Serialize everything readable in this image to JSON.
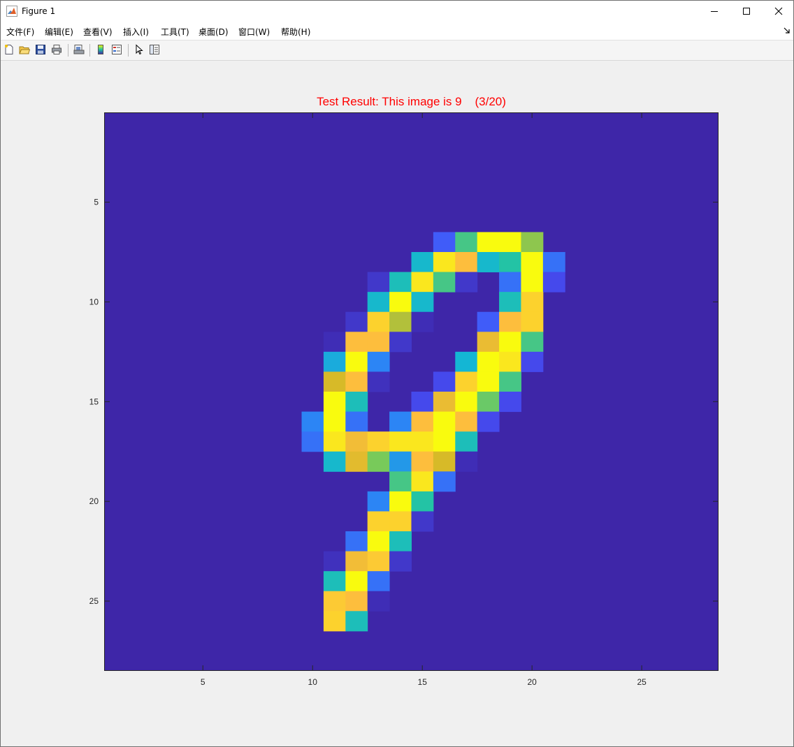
{
  "window": {
    "title": "Figure 1",
    "controls": [
      "minimize",
      "maximize",
      "close"
    ]
  },
  "menu": [
    {
      "label": "文件(F)"
    },
    {
      "label": "编辑(E)"
    },
    {
      "label": "查看(V)"
    },
    {
      "label": "插入(I)"
    },
    {
      "label": "工具(T)"
    },
    {
      "label": "桌面(D)"
    },
    {
      "label": "窗口(W)"
    },
    {
      "label": "帮助(H)"
    }
  ],
  "toolbar": {
    "icons": [
      "new-figure-icon",
      "open-file-icon",
      "save-icon",
      "print-icon",
      "print-preview-icon",
      "colorbar-icon",
      "legend-icon",
      "pointer-icon",
      "property-editor-icon"
    ]
  },
  "plot": {
    "title": "Test Result: This image is 9    (3/20)",
    "title_color": "#ff0000",
    "background_color": "#3e26a8"
  },
  "chart_data": {
    "type": "heatmap",
    "title": "Test Result: This image is 9    (3/20)",
    "xlabel": "",
    "ylabel": "",
    "xlim": [
      0.5,
      28.5
    ],
    "ylim": [
      28.5,
      0.5
    ],
    "y_reversed": true,
    "xticks": [
      5,
      10,
      15,
      20,
      25
    ],
    "yticks": [
      5,
      10,
      15,
      20,
      25
    ],
    "colormap": "parula",
    "clim": [
      0,
      1
    ],
    "grid": false,
    "rows": 28,
    "cols": 28,
    "values": [
      [
        0,
        0,
        0,
        0,
        0,
        0,
        0,
        0,
        0,
        0,
        0,
        0,
        0,
        0,
        0,
        0,
        0,
        0,
        0,
        0,
        0,
        0,
        0,
        0,
        0,
        0,
        0,
        0
      ],
      [
        0,
        0,
        0,
        0,
        0,
        0,
        0,
        0,
        0,
        0,
        0,
        0,
        0,
        0,
        0,
        0,
        0,
        0,
        0,
        0,
        0,
        0,
        0,
        0,
        0,
        0,
        0,
        0
      ],
      [
        0,
        0,
        0,
        0,
        0,
        0,
        0,
        0,
        0,
        0,
        0,
        0,
        0,
        0,
        0,
        0,
        0,
        0,
        0,
        0,
        0,
        0,
        0,
        0,
        0,
        0,
        0,
        0
      ],
      [
        0,
        0,
        0,
        0,
        0,
        0,
        0,
        0,
        0,
        0,
        0,
        0,
        0,
        0,
        0,
        0,
        0,
        0,
        0,
        0,
        0,
        0,
        0,
        0,
        0,
        0,
        0,
        0
      ],
      [
        0,
        0,
        0,
        0,
        0,
        0,
        0,
        0,
        0,
        0,
        0,
        0,
        0,
        0,
        0,
        0,
        0,
        0,
        0,
        0,
        0,
        0,
        0,
        0,
        0,
        0,
        0,
        0
      ],
      [
        0,
        0,
        0,
        0,
        0,
        0,
        0,
        0,
        0,
        0,
        0,
        0,
        0,
        0,
        0,
        0,
        0,
        0,
        0,
        0,
        0,
        0,
        0,
        0,
        0,
        0,
        0,
        0
      ],
      [
        0,
        0,
        0,
        0,
        0,
        0,
        0,
        0,
        0,
        0,
        0,
        0,
        0,
        0,
        0,
        0.15,
        0.55,
        1.0,
        1.0,
        0.65,
        0,
        0,
        0,
        0,
        0,
        0,
        0,
        0
      ],
      [
        0,
        0,
        0,
        0,
        0,
        0,
        0,
        0,
        0,
        0,
        0,
        0,
        0,
        0,
        0.4,
        0.95,
        0.85,
        0.4,
        0.5,
        1.0,
        0.2,
        0,
        0,
        0,
        0,
        0,
        0,
        0
      ],
      [
        0,
        0,
        0,
        0,
        0,
        0,
        0,
        0,
        0,
        0,
        0,
        0,
        0.05,
        0.45,
        0.95,
        0.55,
        0.05,
        0,
        0.2,
        1.0,
        0.1,
        0,
        0,
        0,
        0,
        0,
        0,
        0
      ],
      [
        0,
        0,
        0,
        0,
        0,
        0,
        0,
        0,
        0,
        0,
        0,
        0,
        0.4,
        1.0,
        0.4,
        0,
        0,
        0,
        0.45,
        0.9,
        0,
        0,
        0,
        0,
        0,
        0,
        0,
        0
      ],
      [
        0,
        0,
        0,
        0,
        0,
        0,
        0,
        0,
        0,
        0,
        0,
        0.05,
        0.9,
        0.7,
        0.02,
        0,
        0,
        0.15,
        0.85,
        0.9,
        0,
        0,
        0,
        0,
        0,
        0,
        0,
        0
      ],
      [
        0,
        0,
        0,
        0,
        0,
        0,
        0,
        0,
        0,
        0,
        0.02,
        0.85,
        0.85,
        0.05,
        0,
        0,
        0,
        0.8,
        1.0,
        0.55,
        0,
        0,
        0,
        0,
        0,
        0,
        0,
        0
      ],
      [
        0,
        0,
        0,
        0,
        0,
        0,
        0,
        0,
        0,
        0,
        0.35,
        1.0,
        0.25,
        0,
        0,
        0,
        0.38,
        1.0,
        0.95,
        0.1,
        0,
        0,
        0,
        0,
        0,
        0,
        0,
        0
      ],
      [
        0,
        0,
        0,
        0,
        0,
        0,
        0,
        0,
        0,
        0,
        0.75,
        0.85,
        0.03,
        0,
        0,
        0.1,
        0.9,
        1.0,
        0.55,
        0,
        0,
        0,
        0,
        0,
        0,
        0,
        0,
        0
      ],
      [
        0,
        0,
        0,
        0,
        0,
        0,
        0,
        0,
        0,
        0,
        1.0,
        0.45,
        0,
        0,
        0.1,
        0.8,
        1.0,
        0.6,
        0.1,
        0,
        0,
        0,
        0,
        0,
        0,
        0,
        0,
        0
      ],
      [
        0,
        0,
        0,
        0,
        0,
        0,
        0,
        0,
        0,
        0.25,
        1.0,
        0.2,
        0,
        0.25,
        0.85,
        1.0,
        0.85,
        0.1,
        0,
        0,
        0,
        0,
        0,
        0,
        0,
        0,
        0,
        0
      ],
      [
        0,
        0,
        0,
        0,
        0,
        0,
        0,
        0,
        0,
        0.2,
        0.95,
        0.82,
        0.9,
        0.95,
        0.95,
        1.0,
        0.45,
        0,
        0,
        0,
        0,
        0,
        0,
        0,
        0,
        0,
        0,
        0
      ],
      [
        0,
        0,
        0,
        0,
        0,
        0,
        0,
        0,
        0,
        0,
        0.4,
        0.78,
        0.62,
        0.3,
        0.85,
        0.75,
        0.02,
        0,
        0,
        0,
        0,
        0,
        0,
        0,
        0,
        0,
        0,
        0
      ],
      [
        0,
        0,
        0,
        0,
        0,
        0,
        0,
        0,
        0,
        0,
        0,
        0,
        0,
        0.55,
        0.95,
        0.2,
        0,
        0,
        0,
        0,
        0,
        0,
        0,
        0,
        0,
        0,
        0,
        0
      ],
      [
        0,
        0,
        0,
        0,
        0,
        0,
        0,
        0,
        0,
        0,
        0,
        0,
        0.25,
        1.0,
        0.5,
        0,
        0,
        0,
        0,
        0,
        0,
        0,
        0,
        0,
        0,
        0,
        0,
        0
      ],
      [
        0,
        0,
        0,
        0,
        0,
        0,
        0,
        0,
        0,
        0,
        0,
        0,
        0.9,
        0.9,
        0.05,
        0,
        0,
        0,
        0,
        0,
        0,
        0,
        0,
        0,
        0,
        0,
        0,
        0
      ],
      [
        0,
        0,
        0,
        0,
        0,
        0,
        0,
        0,
        0,
        0,
        0,
        0.2,
        1.0,
        0.45,
        0,
        0,
        0,
        0,
        0,
        0,
        0,
        0,
        0,
        0,
        0,
        0,
        0,
        0
      ],
      [
        0,
        0,
        0,
        0,
        0,
        0,
        0,
        0,
        0,
        0,
        0.03,
        0.82,
        0.88,
        0.05,
        0,
        0,
        0,
        0,
        0,
        0,
        0,
        0,
        0,
        0,
        0,
        0,
        0,
        0
      ],
      [
        0,
        0,
        0,
        0,
        0,
        0,
        0,
        0,
        0,
        0,
        0.45,
        1.0,
        0.2,
        0,
        0,
        0,
        0,
        0,
        0,
        0,
        0,
        0,
        0,
        0,
        0,
        0,
        0,
        0
      ],
      [
        0,
        0,
        0,
        0,
        0,
        0,
        0,
        0,
        0,
        0,
        0.88,
        0.85,
        0.02,
        0,
        0,
        0,
        0,
        0,
        0,
        0,
        0,
        0,
        0,
        0,
        0,
        0,
        0,
        0
      ],
      [
        0,
        0,
        0,
        0,
        0,
        0,
        0,
        0,
        0,
        0,
        0.9,
        0.45,
        0,
        0,
        0,
        0,
        0,
        0,
        0,
        0,
        0,
        0,
        0,
        0,
        0,
        0,
        0,
        0
      ],
      [
        0,
        0,
        0,
        0,
        0,
        0,
        0,
        0,
        0,
        0,
        0,
        0,
        0,
        0,
        0,
        0,
        0,
        0,
        0,
        0,
        0,
        0,
        0,
        0,
        0,
        0,
        0,
        0
      ],
      [
        0,
        0,
        0,
        0,
        0,
        0,
        0,
        0,
        0,
        0,
        0,
        0,
        0,
        0,
        0,
        0,
        0,
        0,
        0,
        0,
        0,
        0,
        0,
        0,
        0,
        0,
        0,
        0
      ]
    ]
  }
}
